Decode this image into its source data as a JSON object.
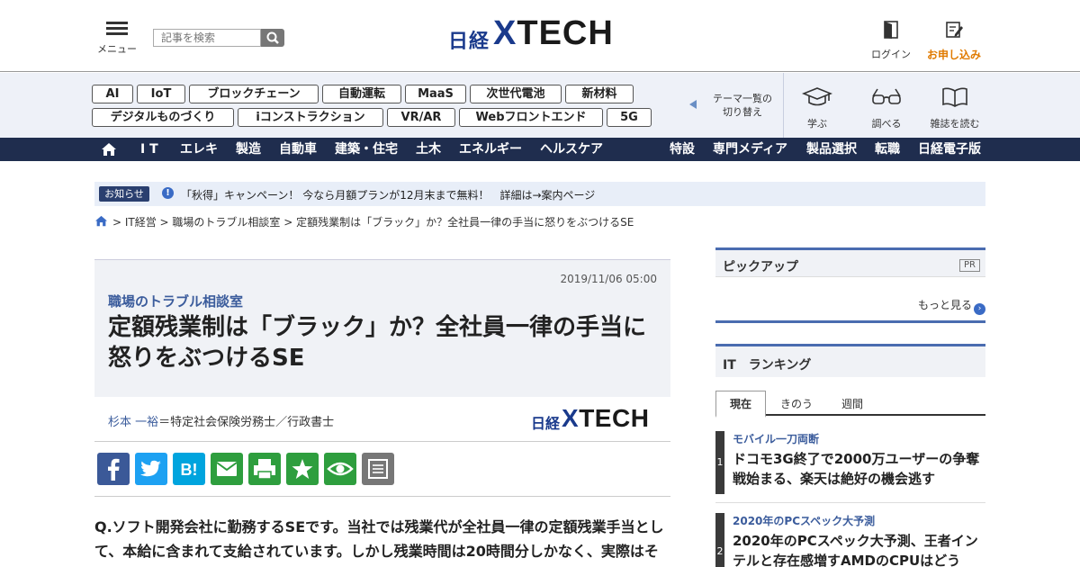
{
  "header": {
    "menu_label": "メニュー",
    "search_placeholder": "記事を検索",
    "logo_nikkei": "日経",
    "logo_x": "X",
    "logo_tech": "TECH",
    "login_label": "ログイン",
    "signup_label": "お申し込み",
    "accent_color": "#e07a00",
    "brand_color": "#1a3a8c"
  },
  "themes": {
    "row1": [
      "AI",
      "IoT",
      "ブロックチェーン",
      "自動運転",
      "MaaS",
      "次世代電池",
      "新材料"
    ],
    "row2": [
      "デジタルものづくり",
      "iコンストラクション",
      "VR/AR",
      "Webフロントエンド",
      "5G"
    ],
    "switch_label_1": "テーマ一覧の",
    "switch_label_2": "切り替え",
    "quick_links": [
      {
        "label": "学ぶ",
        "icon": "graduation-cap-icon"
      },
      {
        "label": "調べる",
        "icon": "glasses-icon"
      },
      {
        "label": "雑誌を読む",
        "icon": "open-book-icon"
      }
    ]
  },
  "nav": {
    "left": [
      "I T",
      "エレキ",
      "製造",
      "自動車",
      "建築・住宅",
      "土木",
      "エネルギー",
      "ヘルスケア"
    ],
    "right": [
      "特設",
      "専門メディア",
      "製品選択",
      "転職",
      "日経電子版"
    ],
    "bg_color": "#1f2d4e"
  },
  "notice": {
    "badge": "お知らせ",
    "text": "「秋得」キャンペーン！ 今なら月額プランが12月末まで無料！　詳細は→案内ページ"
  },
  "breadcrumb": {
    "text": "> IT経営 > 職場のトラブル相談室 > 定額残業制は「ブラック」か？全社員一律の手当に怒りをぶつけるSE"
  },
  "article": {
    "date": "2019/11/06 05:00",
    "series": "職場のトラブル相談室",
    "title": "定額残業制は「ブラック」か？全社員一律の手当に怒りをぶつけるSE",
    "author": "杉本 一裕",
    "author_role": "＝特定社会保険労務士／行政書士",
    "body": "Q.ソフト開発会社に勤務するSEです。当社では残業代が全社員一律の定額残業手当として、本給に含まれて支給されています。しかし残業時間は20時間分しかなく、実際はそ"
  },
  "share_buttons": [
    {
      "name": "facebook",
      "glyph": "f",
      "color": "#3b5998"
    },
    {
      "name": "twitter",
      "glyph": "t",
      "color": "#1da1f2"
    },
    {
      "name": "hatena",
      "glyph": "B!",
      "color": "#00a4de"
    },
    {
      "name": "mail",
      "glyph": "mail",
      "color": "#2e9e3e"
    },
    {
      "name": "print",
      "glyph": "print",
      "color": "#2e9e3e"
    },
    {
      "name": "bookmark",
      "glyph": "★",
      "color": "#2e9e3e"
    },
    {
      "name": "watch",
      "glyph": "eye",
      "color": "#2e9e3e"
    },
    {
      "name": "memo",
      "glyph": "memo",
      "color": "#777777"
    }
  ],
  "sidebar": {
    "pickup_title": "ピックアップ",
    "pickup_pr": "PR",
    "pickup_more": "もっと見る",
    "ranking_title": "IT　ランキング",
    "tabs": [
      "現在",
      "きのう",
      "週間"
    ],
    "ranking": [
      {
        "rank": "1",
        "category": "モバイル一刀両断",
        "title": "ドコモ3G終了で2000万ユーザーの争奪戦始まる、楽天は絶好の機会逃す"
      },
      {
        "rank": "2",
        "category": "2020年のPCスペック大予測",
        "title": "2020年のPCスペック大予測、王者インテルと存在感増すAMDのCPUはどう"
      }
    ]
  }
}
